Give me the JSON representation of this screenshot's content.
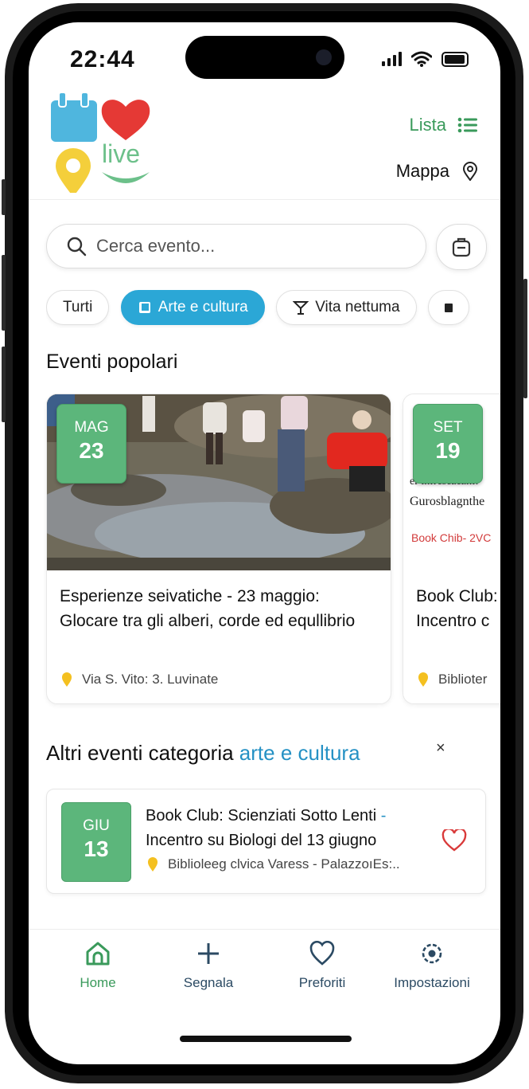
{
  "status_bar": {
    "time": "22:44"
  },
  "header": {
    "logo_text": "live",
    "nav_lista": "Lista",
    "nav_mappa": "Mappa"
  },
  "search": {
    "placeholder": "Cerca evento..."
  },
  "chips": [
    {
      "label": "Turti",
      "icon": ""
    },
    {
      "label": "Arte e cultura",
      "icon": "book-icon"
    },
    {
      "label": "Vita nettuma",
      "icon": "cocktail-icon"
    },
    {
      "label": "",
      "icon": "more-icon"
    }
  ],
  "popular": {
    "title": "Eventi popolari",
    "events": [
      {
        "month": "MAG",
        "day": "23",
        "title": "Esperienze seivatiche - 23 maggio: Glocare tra gli alberi, corde ed equllibrio",
        "location": "Via S. Vito: 3. Luvinate"
      },
      {
        "month": "SET",
        "day": "19",
        "img_line1": "er infresezeznf.",
        "img_line2": "Gurosblagnthe",
        "img_line3": "Book Chib- 2VC",
        "title": "Book Club: Incentro c",
        "location": "Biblioter"
      }
    ]
  },
  "category_section": {
    "title_prefix": "Altri eventi categoria",
    "title_category": "arte e cultura",
    "close_symbol": "×",
    "events": [
      {
        "month": "GIU",
        "day": "13",
        "title": "Book Club: Scienziati Sotto Lenti",
        "title_dash": "-",
        "title_line2": "Incentro su Biologi del 13 giugno",
        "location": "Biblioleeg clvica Varess - PalazzoıEs:.."
      }
    ]
  },
  "tabbar": {
    "items": [
      {
        "label": "Home",
        "icon": "home-icon"
      },
      {
        "label": "Segnala",
        "icon": "plus-icon"
      },
      {
        "label": "Preforiti",
        "icon": "heart-icon"
      },
      {
        "label": "Impostazioni",
        "icon": "settings-icon"
      }
    ]
  },
  "colors": {
    "green": "#5cb67b",
    "accent_blue": "#2ba7d6",
    "link_green": "#3a9a5b",
    "heart_red": "#d93a3a",
    "pin_yellow": "#f4c020"
  }
}
